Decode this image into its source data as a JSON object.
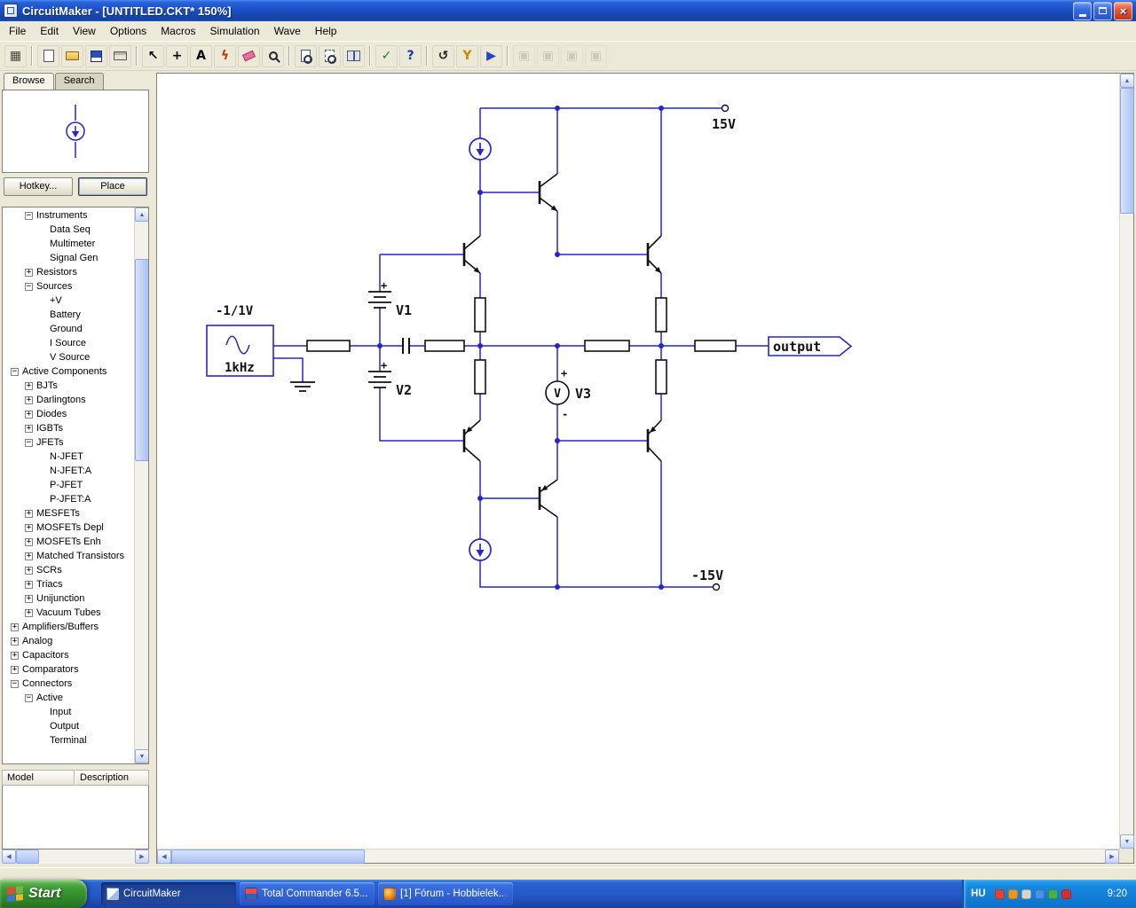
{
  "window": {
    "title": "CircuitMaker - [UNTITLED.CKT* 150%]",
    "menus": [
      "File",
      "Edit",
      "View",
      "Options",
      "Macros",
      "Simulation",
      "Wave",
      "Help"
    ],
    "controls": [
      "minimize",
      "restore",
      "close"
    ]
  },
  "toolbar": {
    "buttons": [
      {
        "name": "panel-toggle"
      },
      {
        "name": "separator"
      },
      {
        "name": "new-file"
      },
      {
        "name": "open-file"
      },
      {
        "name": "save-file"
      },
      {
        "name": "print-file"
      },
      {
        "name": "separator"
      },
      {
        "name": "select-tool"
      },
      {
        "name": "wire-tool"
      },
      {
        "name": "text-tool"
      },
      {
        "name": "delete-tool"
      },
      {
        "name": "erase-tool"
      },
      {
        "name": "zoom-tool"
      },
      {
        "name": "separator"
      },
      {
        "name": "zoom-page-tool"
      },
      {
        "name": "zoom-area-tool"
      },
      {
        "name": "split-view-tool"
      },
      {
        "name": "separator"
      },
      {
        "name": "check-tool"
      },
      {
        "name": "help-tool"
      },
      {
        "name": "separator"
      },
      {
        "name": "reset-tool"
      },
      {
        "name": "probe-tool"
      },
      {
        "name": "run-tool"
      },
      {
        "name": "separator"
      },
      {
        "name": "tile-horizontal-tool",
        "disabled": true
      },
      {
        "name": "tile-vertical-tool",
        "disabled": true
      },
      {
        "name": "cascade-tool",
        "disabled": true
      },
      {
        "name": "arrange-icons-tool",
        "disabled": true
      }
    ]
  },
  "sidebar": {
    "tabs": [
      {
        "label": "Browse",
        "active": true
      },
      {
        "label": "Search",
        "active": false
      }
    ],
    "hotkey_button": "Hotkey...",
    "place_button": "Place",
    "preview_symbol": "i-source-symbol",
    "tree": [
      {
        "label": "Instruments",
        "level": 1,
        "box": "minus"
      },
      {
        "label": "Data Seq",
        "level": 2,
        "box": "none"
      },
      {
        "label": "Multimeter",
        "level": 2,
        "box": "none"
      },
      {
        "label": "Signal Gen",
        "level": 2,
        "box": "none"
      },
      {
        "label": "Resistors",
        "level": 1,
        "box": "plus"
      },
      {
        "label": "Sources",
        "level": 1,
        "box": "minus"
      },
      {
        "label": "+V",
        "level": 2,
        "box": "none"
      },
      {
        "label": "Battery",
        "level": 2,
        "box": "none"
      },
      {
        "label": "Ground",
        "level": 2,
        "box": "none"
      },
      {
        "label": "I Source",
        "level": 2,
        "box": "none"
      },
      {
        "label": "V Source",
        "level": 2,
        "box": "none"
      },
      {
        "label": "Active Components",
        "level": 0,
        "box": "minus"
      },
      {
        "label": "BJTs",
        "level": 1,
        "box": "plus"
      },
      {
        "label": "Darlingtons",
        "level": 1,
        "box": "plus"
      },
      {
        "label": "Diodes",
        "level": 1,
        "box": "plus"
      },
      {
        "label": "IGBTs",
        "level": 1,
        "box": "plus"
      },
      {
        "label": "JFETs",
        "level": 1,
        "box": "minus"
      },
      {
        "label": "N-JFET",
        "level": 2,
        "box": "none"
      },
      {
        "label": "N-JFET:A",
        "level": 2,
        "box": "none"
      },
      {
        "label": "P-JFET",
        "level": 2,
        "box": "none"
      },
      {
        "label": "P-JFET:A",
        "level": 2,
        "box": "none"
      },
      {
        "label": "MESFETs",
        "level": 1,
        "box": "plus"
      },
      {
        "label": "MOSFETs Depl",
        "level": 1,
        "box": "plus"
      },
      {
        "label": "MOSFETs Enh",
        "level": 1,
        "box": "plus"
      },
      {
        "label": "Matched Transistors",
        "level": 1,
        "box": "plus"
      },
      {
        "label": "SCRs",
        "level": 1,
        "box": "plus"
      },
      {
        "label": "Triacs",
        "level": 1,
        "box": "plus"
      },
      {
        "label": "Unijunction",
        "level": 1,
        "box": "plus"
      },
      {
        "label": "Vacuum Tubes",
        "level": 1,
        "box": "plus"
      },
      {
        "label": "Amplifiers/Buffers",
        "level": 0,
        "box": "plus"
      },
      {
        "label": "Analog",
        "level": 0,
        "box": "plus"
      },
      {
        "label": "Capacitors",
        "level": 0,
        "box": "plus"
      },
      {
        "label": "Comparators",
        "level": 0,
        "box": "plus"
      },
      {
        "label": "Connectors",
        "level": 0,
        "box": "minus"
      },
      {
        "label": "Active",
        "level": 1,
        "box": "minus"
      },
      {
        "label": "Input",
        "level": 2,
        "box": "none"
      },
      {
        "label": "Output",
        "level": 2,
        "box": "none"
      },
      {
        "label": "Terminal",
        "level": 2,
        "box": "none"
      }
    ],
    "bottom_headers": [
      "Model",
      "Description"
    ]
  },
  "circuit": {
    "labels": {
      "vplus": "15V",
      "vminus": "-15V",
      "v1": "V1",
      "v2": "V2",
      "v3": "V3",
      "meter_letter": "V",
      "plus_sign": "+",
      "minus_sign": "-",
      "output": "output",
      "source_amp": "-1/1V",
      "source_freq": "1kHz"
    }
  },
  "taskbar": {
    "start_label": "Start",
    "tasks": [
      {
        "label": "CircuitMaker",
        "icon": "circuitmaker-icon",
        "active": true
      },
      {
        "label": "Total Commander 6.5...",
        "icon": "total-commander-icon",
        "active": false
      },
      {
        "label": "[1] Fórum - Hobbielek...",
        "icon": "browser-icon",
        "active": false
      }
    ],
    "tray": {
      "language": "HU",
      "icons": [
        {
          "name": "antivirus-icon",
          "color": "#e04438"
        },
        {
          "name": "update-icon",
          "color": "#e89820"
        },
        {
          "name": "volume-icon",
          "color": "#d8d4c8"
        },
        {
          "name": "network-icon",
          "color": "#4892e0"
        },
        {
          "name": "messenger-icon",
          "color": "#48b048"
        },
        {
          "name": "alert-icon",
          "color": "#d03030"
        }
      ],
      "time": "9:20"
    }
  }
}
